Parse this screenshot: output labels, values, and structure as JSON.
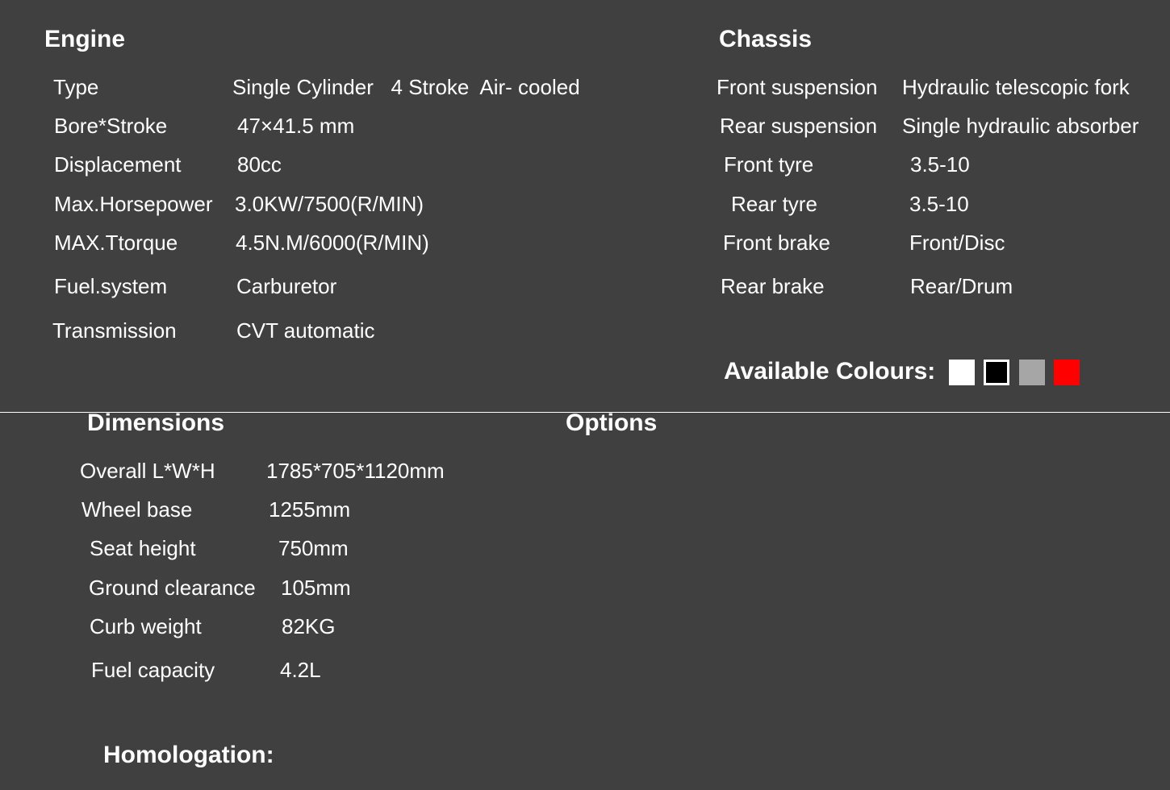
{
  "engine": {
    "title": "Engine",
    "rows": [
      {
        "label": "Type",
        "value": "Single Cylinder   4 Stroke  Air- cooled"
      },
      {
        "label": "Bore*Stroke",
        "value": "47×41.5 mm"
      },
      {
        "label": "Displacement",
        "value": "80cc"
      },
      {
        "label": "Max.Horsepower",
        "value": "3.0KW/7500(R/MIN)"
      },
      {
        "label": "MAX.Ttorque",
        "value": "4.5N.M/6000(R/MIN)"
      },
      {
        "label": "Fuel.system",
        "value": "Carburetor"
      },
      {
        "label": "Transmission",
        "value": "CVT automatic"
      }
    ]
  },
  "chassis": {
    "title": "Chassis",
    "rows": [
      {
        "label": "Front suspension",
        "value": "Hydraulic telescopic fork"
      },
      {
        "label": "Rear suspension",
        "value": "Single hydraulic absorber"
      },
      {
        "label": "Front tyre",
        "value": "3.5-10"
      },
      {
        "label": "Rear tyre",
        "value": "3.5-10"
      },
      {
        "label": "Front brake",
        "value": "Front/Disc"
      },
      {
        "label": "Rear brake",
        "value": "Rear/Drum"
      }
    ]
  },
  "colours": {
    "label": "Available Colours:",
    "swatches": [
      {
        "name": "white",
        "fill": "#ffffff",
        "border": "#ffffff"
      },
      {
        "name": "black",
        "fill": "#000000",
        "border": "#ffffff"
      },
      {
        "name": "grey",
        "fill": "#a6a6a6",
        "border": "#a6a6a6"
      },
      {
        "name": "red",
        "fill": "#ff0000",
        "border": "#ff0000"
      }
    ]
  },
  "dimensions": {
    "title": "Dimensions",
    "rows": [
      {
        "label": "Overall L*W*H",
        "value": "1785*705*1120mm"
      },
      {
        "label": "Wheel base",
        "value": "1255mm"
      },
      {
        "label": "Seat height",
        "value": "750mm"
      },
      {
        "label": "Ground clearance",
        "value": "105mm"
      },
      {
        "label": "Curb weight",
        "value": "82KG"
      },
      {
        "label": "Fuel capacity",
        "value": "4.2L"
      }
    ]
  },
  "options": {
    "title": "Options"
  },
  "homologation": {
    "title": "Homologation:"
  }
}
